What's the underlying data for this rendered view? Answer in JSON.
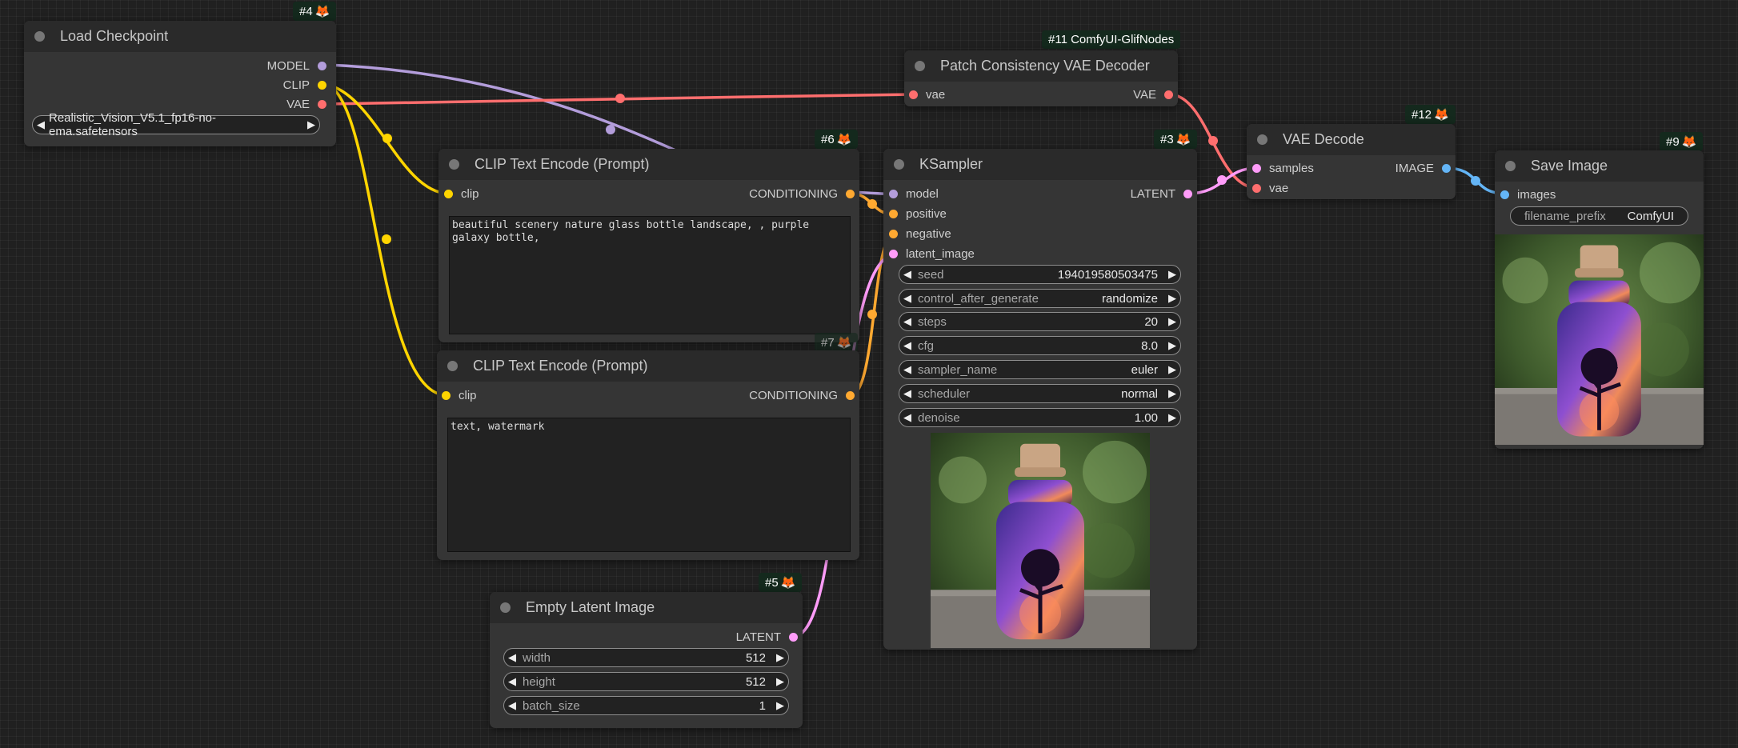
{
  "colors": {
    "model": "#b39ddb",
    "clip": "#ffd500",
    "vae": "#ff6e6e",
    "conditioning": "#ffa931",
    "latent": "#ff9cf9",
    "image": "#64b5f6"
  },
  "nodes": {
    "load_checkpoint": {
      "badge_id": "#4",
      "badge_icon": "fox-icon",
      "title": "Load Checkpoint",
      "outputs": [
        "MODEL",
        "CLIP",
        "VAE"
      ],
      "ckpt_name": "Realistic_Vision_V5.1_fp16-no-ema.safetensors"
    },
    "patch_vae": {
      "badge": "#11 ComfyUI-GlifNodes",
      "title": "Patch Consistency VAE Decoder",
      "input": "vae",
      "output": "VAE"
    },
    "vae_decode": {
      "badge_id": "#12",
      "title": "VAE Decode",
      "inputs": [
        "samples",
        "vae"
      ],
      "output": "IMAGE"
    },
    "save_image": {
      "badge_id": "#9",
      "title": "Save Image",
      "input": "images",
      "filename_prefix_label": "filename_prefix",
      "filename_prefix_value": "ComfyUI"
    },
    "clip_pos": {
      "badge_id": "#6",
      "title": "CLIP Text Encode (Prompt)",
      "input": "clip",
      "output": "CONDITIONING",
      "text": "beautiful scenery nature glass bottle landscape, , purple galaxy bottle,"
    },
    "clip_neg": {
      "badge_id": "#7",
      "title": "CLIP Text Encode (Prompt)",
      "input": "clip",
      "output": "CONDITIONING",
      "text": "text, watermark"
    },
    "ksampler": {
      "badge_id": "#3",
      "title": "KSampler",
      "inputs": [
        "model",
        "positive",
        "negative",
        "latent_image"
      ],
      "output": "LATENT",
      "widgets": [
        {
          "label": "seed",
          "value": "194019580503475"
        },
        {
          "label": "control_after_generate",
          "value": "randomize"
        },
        {
          "label": "steps",
          "value": "20"
        },
        {
          "label": "cfg",
          "value": "8.0"
        },
        {
          "label": "sampler_name",
          "value": "euler"
        },
        {
          "label": "scheduler",
          "value": "normal"
        },
        {
          "label": "denoise",
          "value": "1.00"
        }
      ]
    },
    "empty_latent": {
      "badge_id": "#5",
      "title": "Empty Latent Image",
      "output": "LATENT",
      "widgets": [
        {
          "label": "width",
          "value": "512"
        },
        {
          "label": "height",
          "value": "512"
        },
        {
          "label": "batch_size",
          "value": "1"
        }
      ]
    }
  }
}
